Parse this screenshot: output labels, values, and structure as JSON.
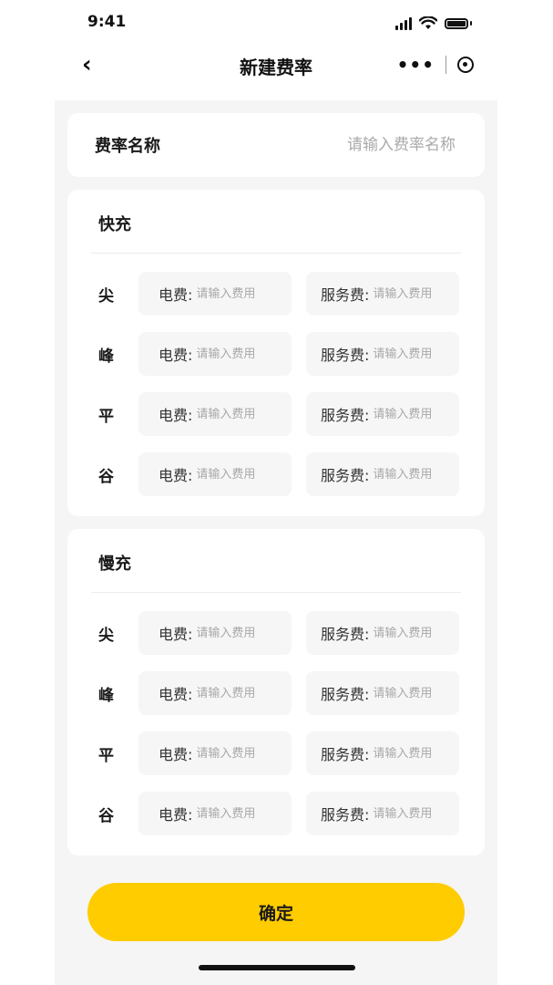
{
  "status_bar": {
    "time": "9:41"
  },
  "nav": {
    "back_label": "‹",
    "title": "新建费率",
    "more_label": "•••"
  },
  "rate_name": {
    "label": "费率名称",
    "placeholder": "请输入费率名称"
  },
  "fast": {
    "title": "快充",
    "rows": [
      {
        "period": "尖",
        "elec_label": "电费:",
        "elec_placeholder": "请输入费用",
        "service_label": "服务费:",
        "service_placeholder": "请输入费用"
      },
      {
        "period": "峰",
        "elec_label": "电费:",
        "elec_placeholder": "请输入费用",
        "service_label": "服务费:",
        "service_placeholder": "请输入费用"
      },
      {
        "period": "平",
        "elec_label": "电费:",
        "elec_placeholder": "请输入费用",
        "service_label": "服务费:",
        "service_placeholder": "请输入费用"
      },
      {
        "period": "谷",
        "elec_label": "电费:",
        "elec_placeholder": "请输入费用",
        "service_label": "服务费:",
        "service_placeholder": "请输入费用"
      }
    ]
  },
  "slow": {
    "title": "慢充",
    "rows": [
      {
        "period": "尖",
        "elec_label": "电费:",
        "elec_placeholder": "请输入费用",
        "service_label": "服务费:",
        "service_placeholder": "请输入费用"
      },
      {
        "period": "峰",
        "elec_label": "电费:",
        "elec_placeholder": "请输入费用",
        "service_label": "服务费:",
        "service_placeholder": "请输入费用"
      },
      {
        "period": "平",
        "elec_label": "电费:",
        "elec_placeholder": "请输入费用",
        "service_label": "服务费:",
        "service_placeholder": "请输入费用"
      },
      {
        "period": "谷",
        "elec_label": "电费:",
        "elec_placeholder": "请输入费用",
        "service_label": "服务费:",
        "service_placeholder": "请输入费用"
      }
    ]
  },
  "confirm_label": "确定",
  "colors": {
    "accent": "#ffcc00",
    "background": "#f5f5f5",
    "field_bg": "#f6f6f6"
  }
}
